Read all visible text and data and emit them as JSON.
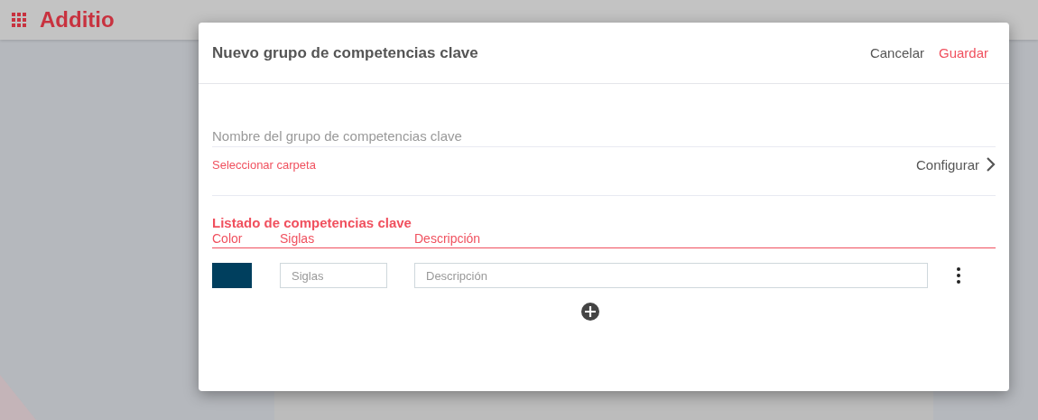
{
  "app": {
    "logo": "Additio"
  },
  "dialog": {
    "title": "Nuevo grupo de competencias clave",
    "actions": [
      {
        "label": "Cancelar",
        "kind": "secondary"
      },
      {
        "label": "Guardar",
        "kind": "primary"
      }
    ],
    "name_field": {
      "placeholder": "Nombre del grupo de competencias clave"
    },
    "folder_link": "Seleccionar carpeta",
    "configure": "Configurar",
    "list": {
      "title": "Listado de competencias clave",
      "columns": [
        "Color",
        "Siglas",
        "Descripción"
      ],
      "rows": [
        {
          "color": "#003f5e",
          "siglas": {
            "placeholder": "Siglas"
          },
          "descripcion": {
            "placeholder": "Descripción"
          }
        }
      ]
    }
  }
}
